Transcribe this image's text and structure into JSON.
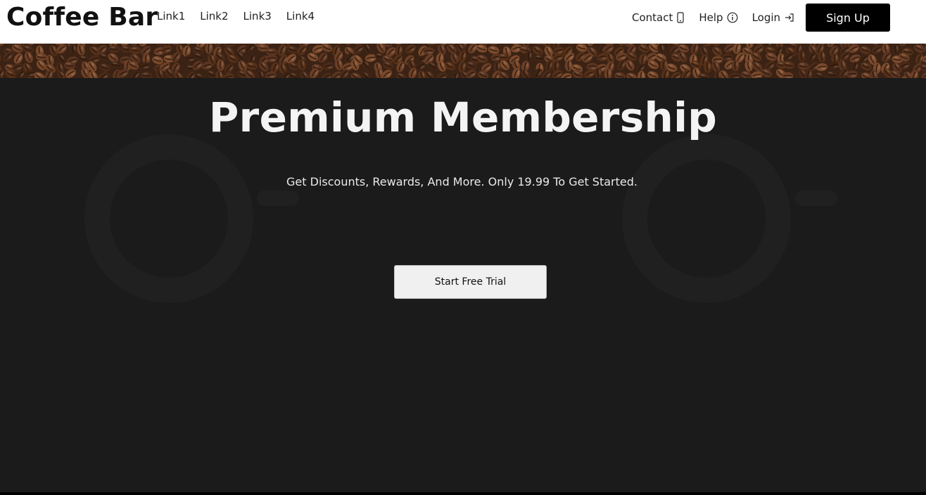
{
  "header": {
    "brand": "Coffee Bar",
    "links": [
      "Link1",
      "Link2",
      "Link3",
      "Link4"
    ],
    "contact_label": "Contact",
    "help_label": "Help",
    "login_label": "Login",
    "signup_label": "Sign Up"
  },
  "hero": {
    "title": "Premium Membership",
    "subtitle": "Get Discounts, Rewards, And More. Only 19.99 To Get Started.",
    "cta_label": "Start Free Trial"
  },
  "icons": {
    "contact": "phone-icon",
    "help": "info-icon",
    "login": "login-icon"
  },
  "colors": {
    "header_bg": "#ffffff",
    "hero_bg": "#1b1b1b",
    "signup_bg": "#000000",
    "cta_bg": "#f0f0f0"
  }
}
